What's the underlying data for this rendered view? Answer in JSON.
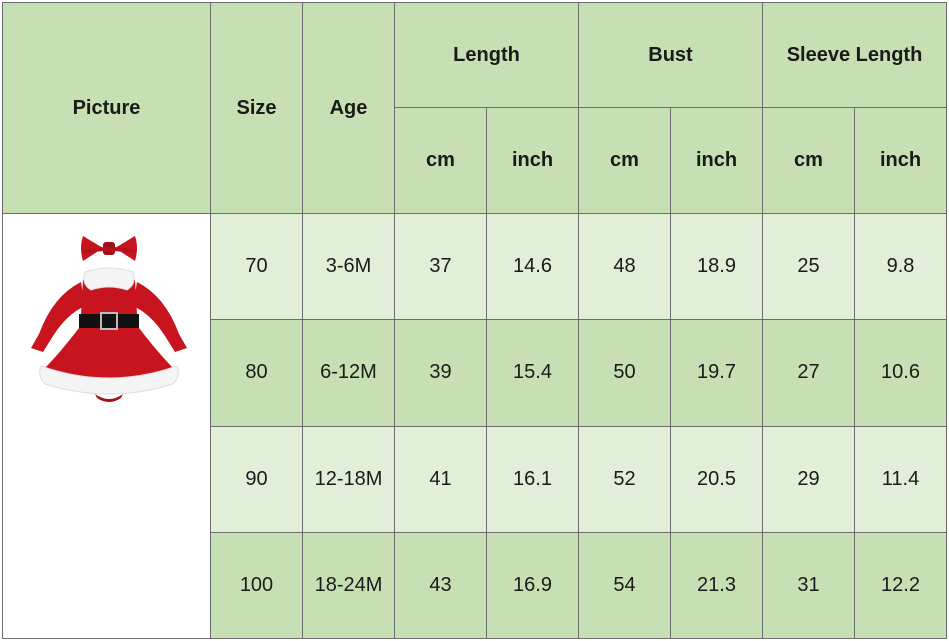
{
  "header": {
    "picture": "Picture",
    "size": "Size",
    "age": "Age",
    "length": "Length",
    "bust": "Bust",
    "sleeve_length": "Sleeve Length",
    "units": [
      "cm",
      "inch",
      "cm",
      "inch",
      "cm",
      "inch"
    ]
  },
  "product_image": {
    "icon": "santa-dress-image",
    "colors": {
      "dress": "#c8141e",
      "fur": "#f4f4f4",
      "belt": "#111111"
    }
  },
  "rows": [
    [
      "70",
      "3-6M",
      "37",
      "14.6",
      "48",
      "18.9",
      "25",
      "9.8"
    ],
    [
      "80",
      "6-12M",
      "39",
      "15.4",
      "50",
      "19.7",
      "27",
      "10.6"
    ],
    [
      "90",
      "12-18M",
      "41",
      "16.1",
      "52",
      "20.5",
      "29",
      "11.4"
    ],
    [
      "100",
      "18-24M",
      "43",
      "16.9",
      "54",
      "21.3",
      "31",
      "12.2"
    ]
  ],
  "colors": {
    "header": "#c6e0b3",
    "row_light": "#e1efd8",
    "row_dark": "#c6e0b3",
    "border": "#6d6d6d"
  }
}
